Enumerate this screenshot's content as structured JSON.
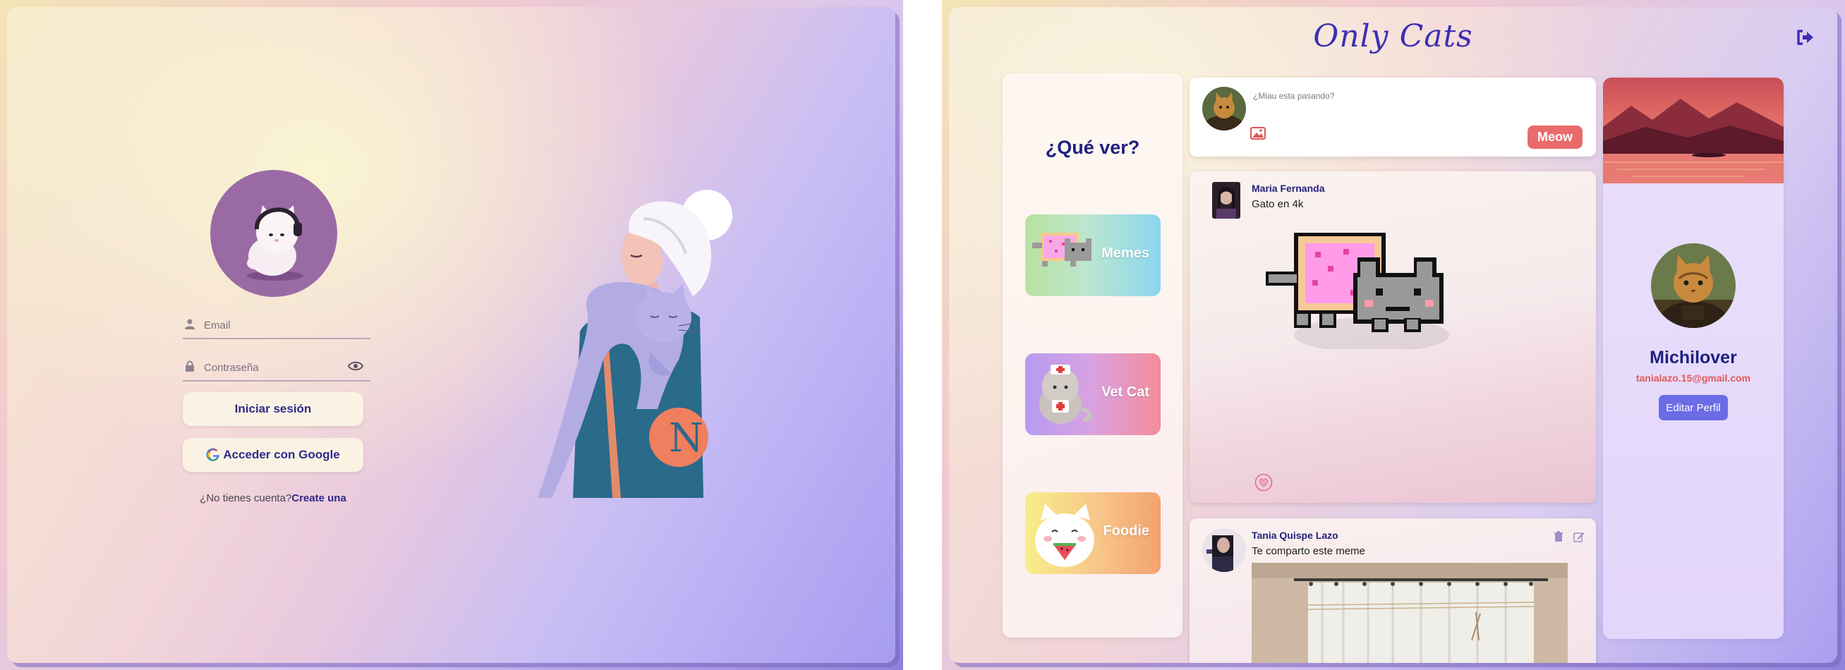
{
  "login": {
    "email_placeholder": "Email",
    "password_placeholder": "Contraseña",
    "login_button": "Iniciar sesión",
    "google_button": "Acceder con Google",
    "no_account_text": "¿No tienes cuenta?",
    "create_link": "Create una"
  },
  "feed": {
    "app_title": "Only Cats",
    "categories": {
      "title": "¿Qué ver?",
      "items": [
        {
          "label": "Memes"
        },
        {
          "label": "Vet Cat"
        },
        {
          "label": "Foodie"
        }
      ]
    },
    "composer": {
      "placeholder": "¿Miau esta pasando?",
      "submit_label": "Meow"
    },
    "posts": [
      {
        "author": "Maria Fernanda",
        "text": "Gato en 4k"
      },
      {
        "author": "Tania Quispe Lazo",
        "text": "Te comparto este meme"
      }
    ],
    "profile": {
      "name": "Michilover",
      "email": "tanialazo.15@gmail.com",
      "edit_label": "Editar Perfil"
    }
  },
  "colors": {
    "accent_blue": "#2e2a8c",
    "meow_red": "#ea6b6b",
    "edit_purple": "#6b6ce6",
    "email_red": "#e05a5a"
  },
  "icons": [
    "user-icon",
    "lock-icon",
    "eye-icon",
    "google-icon",
    "logout-icon",
    "image-icon",
    "heart-icon",
    "trash-icon",
    "edit-icon"
  ]
}
